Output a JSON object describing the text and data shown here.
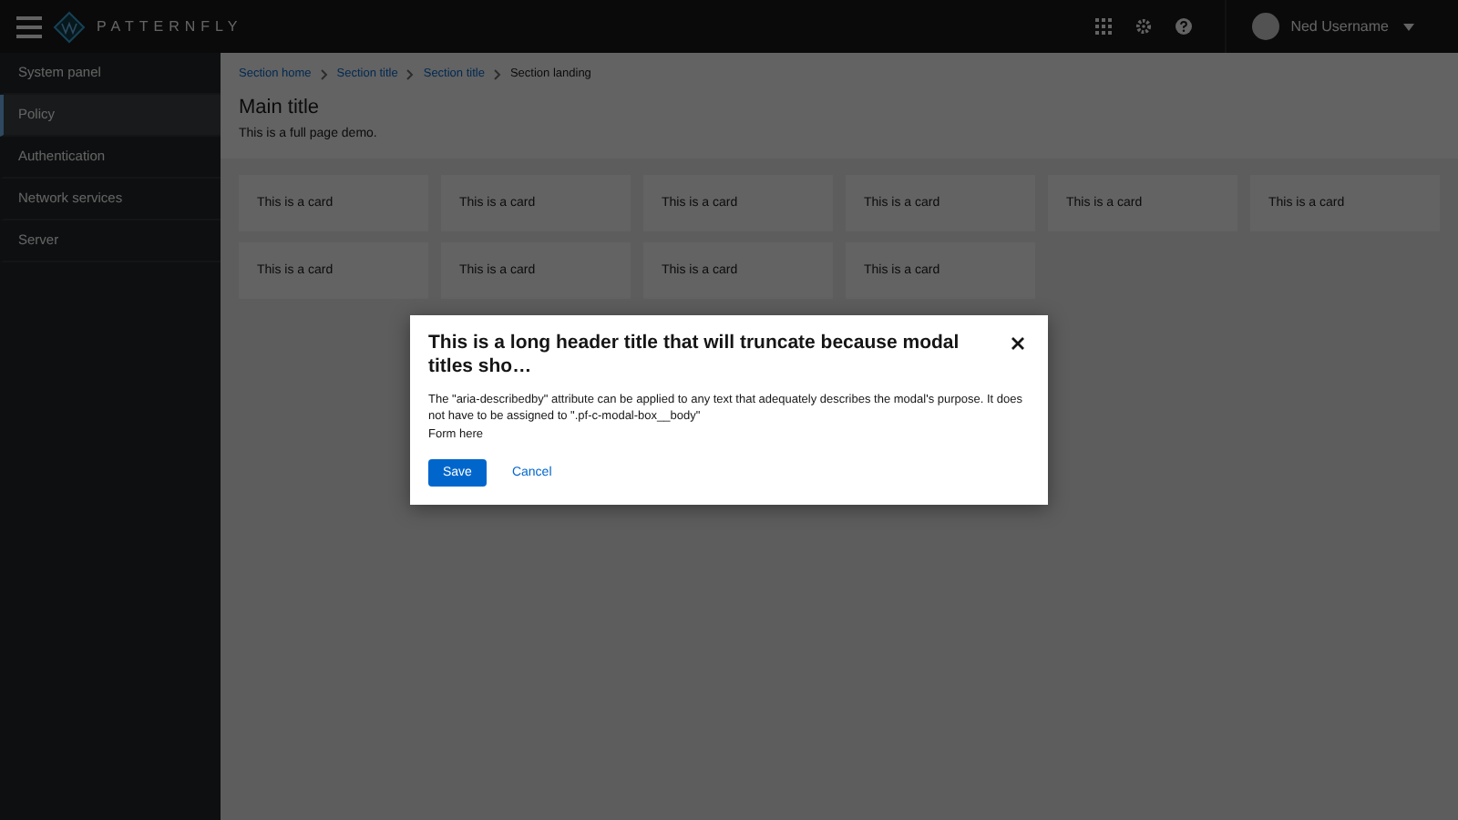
{
  "header": {
    "brand": "PATTERNFLY",
    "user": "Ned Username"
  },
  "sidebar": {
    "items": [
      {
        "label": "System panel",
        "selected": false
      },
      {
        "label": "Policy",
        "selected": true
      },
      {
        "label": "Authentication",
        "selected": false
      },
      {
        "label": "Network services",
        "selected": false
      },
      {
        "label": "Server",
        "selected": false
      }
    ]
  },
  "breadcrumbs": [
    {
      "label": "Section home",
      "kind": "link"
    },
    {
      "label": "Section title",
      "kind": "link"
    },
    {
      "label": "Section title",
      "kind": "link"
    },
    {
      "label": "Section landing",
      "kind": "current"
    }
  ],
  "page": {
    "title": "Main title",
    "description": "This is a full page demo."
  },
  "cards": [
    "This is a card",
    "This is a card",
    "This is a card",
    "This is a card",
    "This is a card",
    "This is a card",
    "This is a card",
    "This is a card",
    "This is a card",
    "This is a card"
  ],
  "modal": {
    "title": "This is a long header title that will truncate because modal titles sho…",
    "body": "The \"aria-describedby\" attribute can be applied to any text that adequately describes the modal's purpose. It does not have to be assigned to \".pf-c-modal-box__body\"",
    "form": "Form here",
    "buttons": [
      {
        "label": "Save",
        "kind": "primary"
      },
      {
        "label": "Cancel",
        "kind": "link"
      }
    ]
  }
}
